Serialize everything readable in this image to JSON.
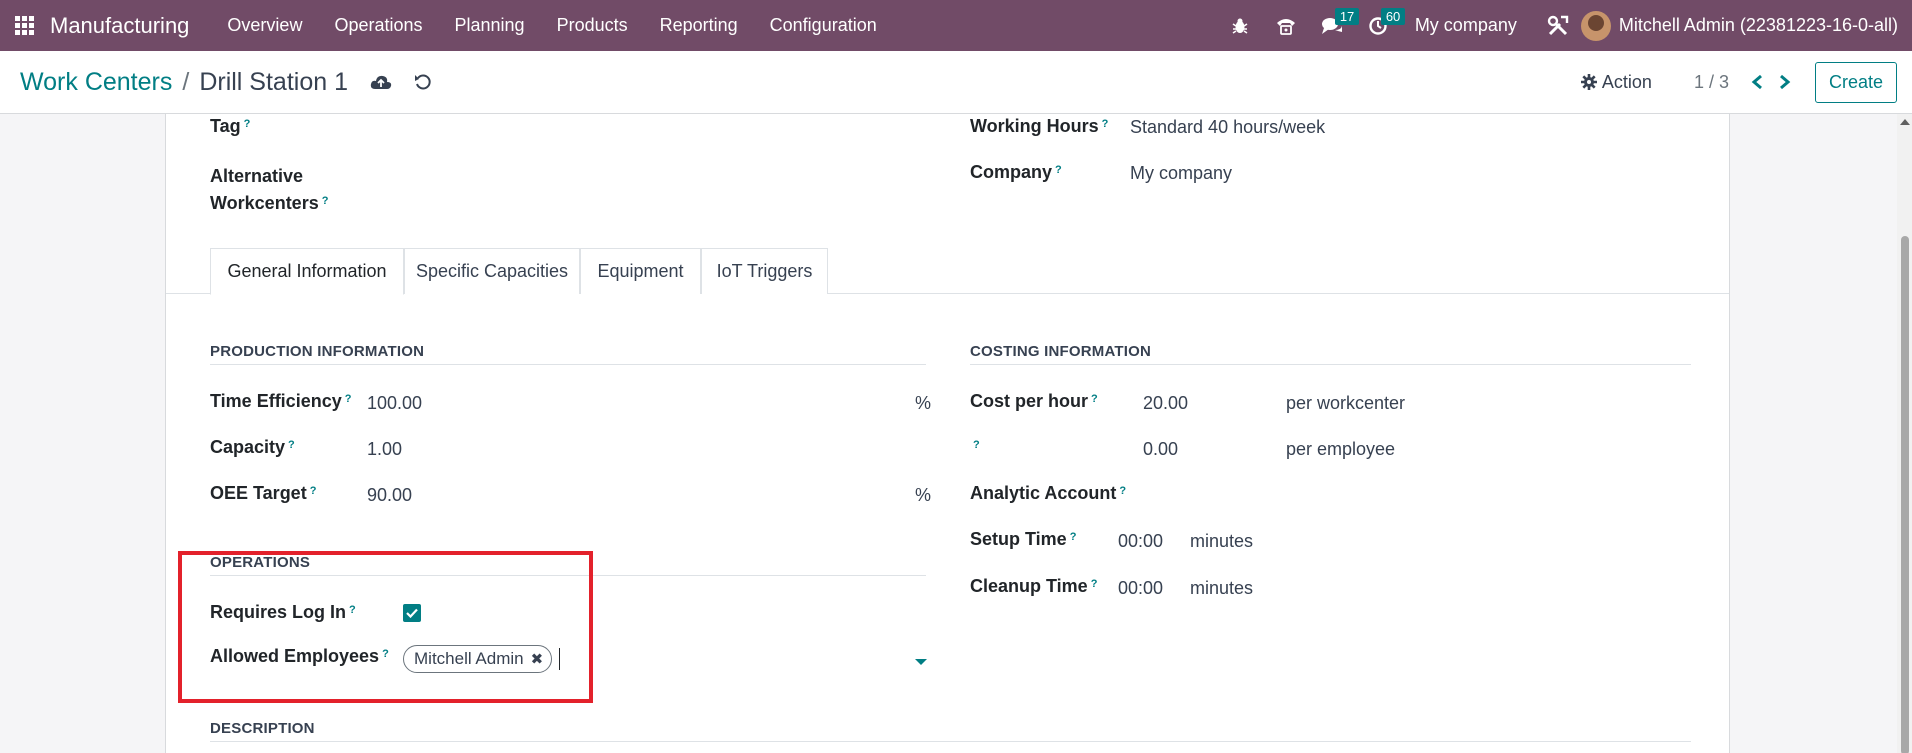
{
  "navbar": {
    "app_name": "Manufacturing",
    "menu": [
      "Overview",
      "Operations",
      "Planning",
      "Products",
      "Reporting",
      "Configuration"
    ],
    "messages_count": "17",
    "activities_count": "60",
    "company": "My company",
    "user": "Mitchell Admin (22381223-16-0-all)"
  },
  "control": {
    "breadcrumb_parent": "Work Centers",
    "breadcrumb_sep": "/",
    "breadcrumb_current": "Drill Station 1",
    "action_label": "Action",
    "pager": "1 / 3",
    "create_label": "Create"
  },
  "form": {
    "tag_label": "Tag",
    "alt_label_1": "Alternative",
    "alt_label_2": "Workcenters",
    "working_hours_label": "Working Hours",
    "working_hours_value": "Standard 40 hours/week",
    "company_label": "Company",
    "company_value": "My company",
    "help_mark": "?"
  },
  "tabs": [
    "General Information",
    "Specific Capacities",
    "Equipment",
    "IoT Triggers"
  ],
  "production": {
    "title": "PRODUCTION INFORMATION",
    "time_efficiency_label": "Time Efficiency",
    "time_efficiency_value": "100.00",
    "time_efficiency_unit": "%",
    "capacity_label": "Capacity",
    "capacity_value": "1.00",
    "oee_label": "OEE Target",
    "oee_value": "90.00",
    "oee_unit": "%"
  },
  "costing": {
    "title": "COSTING INFORMATION",
    "cost_label": "Cost per hour",
    "cost_value": "20.00",
    "cost_unit": "per workcenter",
    "employee_cost_value": "0.00",
    "employee_cost_unit": "per employee",
    "analytic_label": "Analytic Account",
    "setup_label": "Setup Time",
    "setup_value": "00:00",
    "setup_unit": "minutes",
    "cleanup_label": "Cleanup Time",
    "cleanup_value": "00:00",
    "cleanup_unit": "minutes"
  },
  "operations": {
    "title": "OPERATIONS",
    "requires_login_label": "Requires Log In",
    "requires_login_checked": true,
    "allowed_employees_label": "Allowed Employees",
    "allowed_employees": [
      "Mitchell Admin"
    ]
  },
  "description": {
    "title": "DESCRIPTION"
  },
  "colors": {
    "navbar": "#714b67",
    "accent": "#017e84",
    "highlight": "#e3212b"
  }
}
